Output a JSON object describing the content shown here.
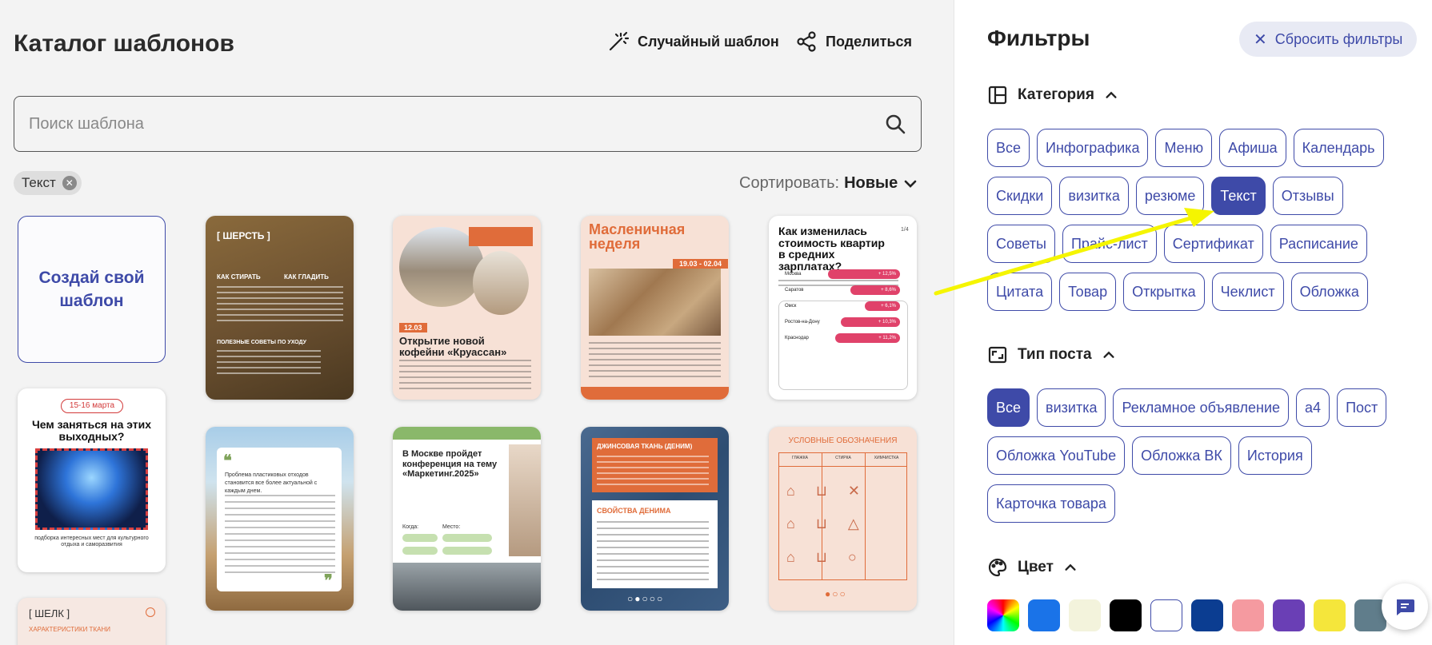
{
  "header": {
    "title": "Каталог шаблонов",
    "random_label": "Случайный шаблон",
    "share_label": "Поделиться"
  },
  "search": {
    "placeholder": "Поиск шаблона",
    "value": ""
  },
  "active_filter": {
    "label": "Текст"
  },
  "sort": {
    "label": "Сортировать:",
    "value": "Новые"
  },
  "create_card": {
    "label": "Создай свой шаблон"
  },
  "templates": {
    "wool": {
      "title": "[ ШЕРСТЬ ]",
      "col1": "КАК СТИРАТЬ",
      "col2": "КАК ГЛАДИТЬ",
      "sub": "ПОЛЕЗНЫЕ СОВЕТЫ ПО УХОДУ"
    },
    "cafe": {
      "date": "12.03",
      "title": "Открытие новой кофейни «Круассан»"
    },
    "maslenitsa": {
      "title": "Масленичная неделя",
      "dates": "19.03 - 02.04"
    },
    "apartments": {
      "title": "Как изменилась стоимость квартир в средних зарплатах?",
      "page": "1/4",
      "rows": [
        {
          "city": "Москва",
          "value": "+ 12,5%"
        },
        {
          "city": "Саратов",
          "value": "+ 8,6%"
        },
        {
          "city": "Омск",
          "value": "+ 6,1%"
        },
        {
          "city": "Ростов-на-Дону",
          "value": "+ 10,3%"
        },
        {
          "city": "Краснодар",
          "value": "+ 11,2%"
        }
      ]
    },
    "weekend": {
      "badge": "15-16 марта",
      "title": "Чем заняться на этих выходных?",
      "caption": "подборка интересных мест для культурного отдыха и саморазвития"
    },
    "silk": {
      "title": "[ ШЕЛК ]",
      "sub": "ХАРАКТЕРИСТИКИ ТКАНИ"
    },
    "plastic": {
      "text": "Проблема пластиковых отходов становится все более актуальной с каждым днем."
    },
    "conference": {
      "title": "В Москве пройдет конференция на тему «Маркетинг.2025»",
      "when_label": "Когда:",
      "where_label": "Место:"
    },
    "denim": {
      "title": "ДЖИНСОВАЯ ТКАНЬ (ДЕНИМ)",
      "sub": "СВОЙСТВА ДЕНИМА"
    },
    "symbols": {
      "title": "УСЛОВНЫЕ ОБОЗНАЧЕНИЯ",
      "cols": [
        "ГЛАЖКА",
        "СТИРКА",
        "ХИМЧИСТКА"
      ]
    }
  },
  "filters": {
    "title": "Фильтры",
    "reset_label": "Сбросить фильтры",
    "category": {
      "label": "Категория",
      "items": [
        "Все",
        "Инфографика",
        "Меню",
        "Афиша",
        "Календарь",
        "Скидки",
        "визитка",
        "резюме",
        "Текст",
        "Отзывы",
        "Советы",
        "Прайс-лист",
        "Сертификат",
        "Расписание",
        "Цитата",
        "Товар",
        "Открытка",
        "Чеклист",
        "Обложка"
      ],
      "selected": "Текст"
    },
    "post_type": {
      "label": "Тип поста",
      "items": [
        "Все",
        "визитка",
        "Рекламное объявление",
        "а4",
        "Пост",
        "Обложка YouTube",
        "Обложка ВК",
        "История",
        "Карточка товара"
      ],
      "selected": "Все"
    },
    "color": {
      "label": "Цвет",
      "swatches": [
        "rainbow",
        "#1a73e8",
        "#f3f3dc",
        "#000000",
        "#ffffff",
        "#0b3d91",
        "#f59aa0",
        "#6a3fb5",
        "#f5e63b",
        "#607d8b"
      ]
    }
  },
  "colors": {
    "accent": "#3e4aa8",
    "annotation_arrow": "#f5f500"
  }
}
